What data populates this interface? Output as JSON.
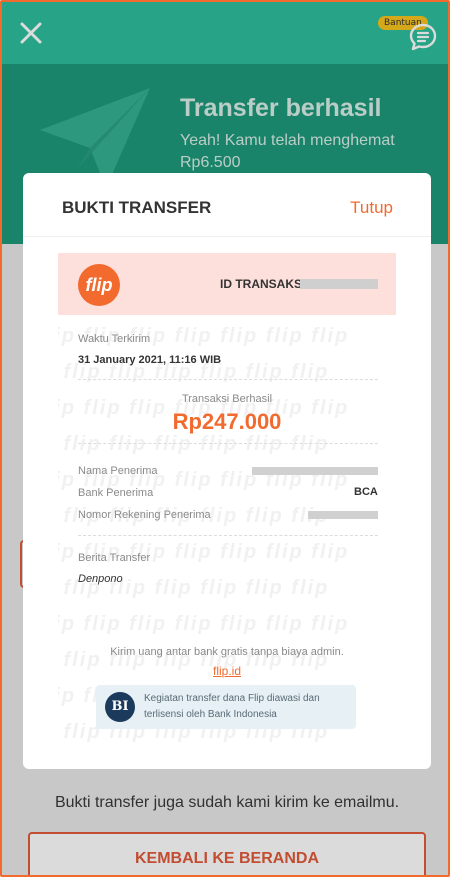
{
  "topbar": {
    "help_badge": "Bantuan",
    "close_icon": "close-icon",
    "chat_icon": "chat-help-icon"
  },
  "success": {
    "title": "Transfer berhasil",
    "subtitle": "Yeah! Kamu telah menghemat Rp6.500"
  },
  "modal": {
    "title": "BUKTI TRANSFER",
    "close_label": "Tutup"
  },
  "receipt": {
    "logo_text": "flip",
    "trx_label": "ID TRANSAKSI",
    "sent_time_label": "Waktu Terkirim",
    "sent_time_value": "31 January 2021, 11:16 WIB",
    "status_label": "Transaksi Berhasil",
    "amount": "Rp247.000",
    "recipient_name_label": "Nama Penerima",
    "recipient_bank_label": "Bank Penerima",
    "recipient_bank_value": "BCA",
    "account_number_label": "Nomor Rekening Penerima",
    "message_label": "Berita Transfer",
    "message_value": "Denpono",
    "footer_note": "Kirim uang antar bank gratis tanpa biaya admin.",
    "footer_link": "flip.id",
    "bi_logo": "BI",
    "bi_text": "Kegiatan transfer dana Flip diawasi dan terlisensi oleh Bank Indonesia"
  },
  "page": {
    "email_note": "Bukti transfer juga sudah kami kirim ke emailmu.",
    "home_button": "KEMBALI KE BERANDA"
  },
  "colors": {
    "accent": "#f26a2e",
    "topbar": "#2ebf9e",
    "header": "#1e9a7c"
  }
}
